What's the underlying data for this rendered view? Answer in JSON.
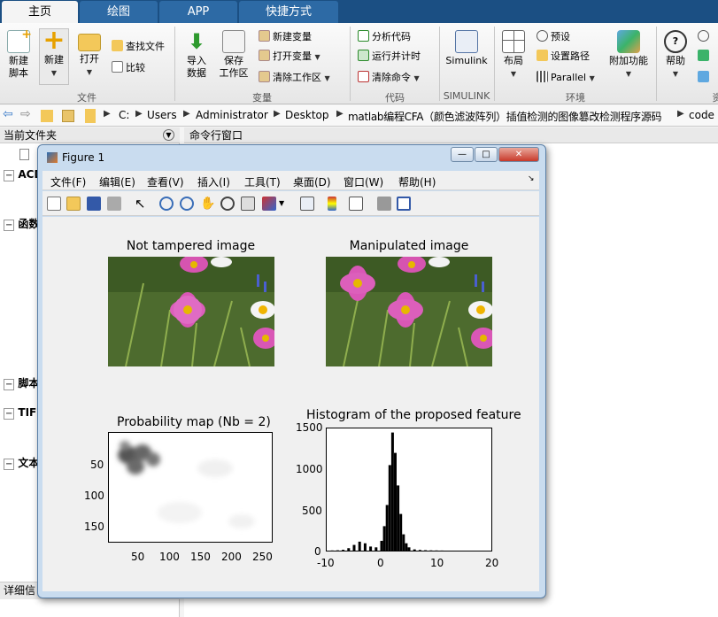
{
  "tabs": [
    "主页",
    "绘图",
    "APP",
    "快捷方式"
  ],
  "ribbon": {
    "new_script": "新建\n脚本",
    "new": "新建",
    "open": "打开",
    "find_files": "查找文件",
    "compare": "比较",
    "group_file": "文件",
    "import_data": "导入\n数据",
    "save_workspace": "保存\n工作区",
    "new_variable": "新建变量",
    "open_variable": "打开变量",
    "clear_workspace": "清除工作区",
    "group_variable": "变量",
    "analyze_code": "分析代码",
    "run_timing": "运行并计时",
    "clear_commands": "清除命令",
    "group_code": "代码",
    "simulink": "Simulink",
    "group_simulink": "SIMULINK",
    "layout": "布局",
    "preferences": "预设",
    "set_path": "设置路径",
    "parallel": "Parallel",
    "add_ons": "附加功能",
    "group_env": "环境",
    "help": "帮助",
    "group_resources": "资"
  },
  "address": {
    "crumbs": [
      "C:",
      "Users",
      "Administrator",
      "Desktop",
      "matlab编程CFA（颜色滤波阵列）插值检测的图像篡改检测程序源码",
      "code"
    ]
  },
  "panels": {
    "current_folder": "当前文件夹",
    "command_window": "命令行窗口",
    "details": "详细信",
    "left_items": [
      "ACD",
      "函数",
      "脚本",
      "TIFF",
      "文本"
    ]
  },
  "figure": {
    "title": "Figure 1",
    "menus": [
      "文件(F)",
      "编辑(E)",
      "查看(V)",
      "插入(I)",
      "工具(T)",
      "桌面(D)",
      "窗口(W)",
      "帮助(H)"
    ],
    "plot_titles": {
      "original": "Not tampered image",
      "manipulated": "Manipulated image",
      "probability": "Probability map (Nb = 2)",
      "histogram": "Histogram of the proposed feature"
    },
    "prob_y_ticks": [
      "50",
      "100",
      "150"
    ],
    "prob_x_ticks": [
      "50",
      "100",
      "150",
      "200",
      "250"
    ],
    "hist_y_ticks": [
      "1500",
      "1000",
      "500",
      "0"
    ],
    "hist_x_ticks": [
      "-10",
      "0",
      "10",
      "20"
    ]
  },
  "chart_data": {
    "type": "bar",
    "title": "Histogram of the proposed feature",
    "xlabel": "",
    "ylabel": "",
    "xlim": [
      -10,
      20
    ],
    "ylim": [
      0,
      1500
    ],
    "x": [
      -9,
      -8,
      -7,
      -6,
      -5,
      -4,
      -3,
      -2,
      -1,
      0,
      0.5,
      1,
      1.5,
      2,
      2.5,
      3,
      3.5,
      4,
      4.5,
      5,
      6,
      7,
      8,
      9,
      10,
      11,
      12
    ],
    "values": [
      2,
      4,
      10,
      30,
      70,
      110,
      90,
      50,
      40,
      120,
      300,
      560,
      1050,
      1450,
      1200,
      800,
      450,
      200,
      90,
      40,
      15,
      8,
      5,
      3,
      2,
      1,
      0
    ]
  }
}
